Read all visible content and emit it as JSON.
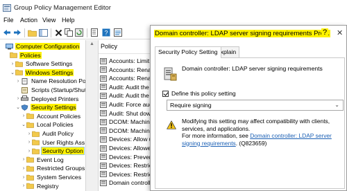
{
  "window": {
    "title": "Group Policy Management Editor"
  },
  "menu": [
    "File",
    "Action",
    "View",
    "Help"
  ],
  "toolbar": {
    "icons": [
      "back-icon",
      "forward-icon",
      "up-folder-icon",
      "show-hide-tree-icon",
      "delete-icon",
      "copy-icon",
      "refresh-icon",
      "export-list-icon",
      "help-icon",
      "properties-icon"
    ]
  },
  "tree": {
    "items": [
      {
        "label": "Computer Configuration",
        "level": 0,
        "expander": "",
        "icon": "computer-icon",
        "highlight": true
      },
      {
        "label": "Policies",
        "level": 1,
        "expander": "",
        "icon": "folder-icon",
        "highlight": true
      },
      {
        "label": "Software Settings",
        "level": 2,
        "expander": ">",
        "icon": "folder-icon",
        "highlight": false
      },
      {
        "label": "Windows Settings",
        "level": 2,
        "expander": "v",
        "icon": "folder-icon",
        "highlight": true
      },
      {
        "label": "Name Resolution Polic",
        "level": 3,
        "expander": ">",
        "icon": "document-icon",
        "highlight": false
      },
      {
        "label": "Scripts (Startup/Shutd",
        "level": 3,
        "expander": "",
        "icon": "scroll-icon",
        "highlight": false
      },
      {
        "label": "Deployed Printers",
        "level": 3,
        "expander": ">",
        "icon": "printer-icon",
        "highlight": false
      },
      {
        "label": "Security Settings",
        "level": 3,
        "expander": "v",
        "icon": "shield-icon",
        "highlight": true
      },
      {
        "label": "Account Policies",
        "level": 4,
        "expander": ">",
        "icon": "folder-icon",
        "highlight": false
      },
      {
        "label": "Local Policies",
        "level": 4,
        "expander": "v",
        "icon": "folder-icon",
        "highlight": false
      },
      {
        "label": "Audit Policy",
        "level": 5,
        "expander": ">",
        "icon": "folder-icon",
        "highlight": false
      },
      {
        "label": "User Rights Ass",
        "level": 5,
        "expander": ">",
        "icon": "folder-icon",
        "highlight": false
      },
      {
        "label": "Security Option",
        "level": 5,
        "expander": ">",
        "icon": "folder-icon",
        "highlight": true,
        "selected": true
      },
      {
        "label": "Event Log",
        "level": 4,
        "expander": ">",
        "icon": "folder-icon",
        "highlight": false
      },
      {
        "label": "Restricted Groups",
        "level": 4,
        "expander": ">",
        "icon": "folder-icon",
        "highlight": false
      },
      {
        "label": "System Services",
        "level": 4,
        "expander": ">",
        "icon": "folder-icon",
        "highlight": false
      },
      {
        "label": "Registry",
        "level": 4,
        "expander": ">",
        "icon": "folder-icon",
        "highlight": false
      }
    ]
  },
  "policy_list": {
    "header": "Policy",
    "rows": [
      "Accounts: Limit",
      "Accounts: Renar",
      "Accounts: Renar",
      "Audit: Audit the",
      "Audit: Audit the",
      "Audit: Force aud",
      "Audit: Shut dow",
      "DCOM: Machine",
      "DCOM: Machine",
      "Devices: Allow u",
      "Devices: Allowed",
      "Devices: Prevent",
      "Devices: Restrict",
      "Devices: Restrict",
      "Domain controlle"
    ]
  },
  "dialog": {
    "title": "Domain controller: LDAP server signing requirements Pro...",
    "help_label": "?",
    "close_label": "✕",
    "tabs": [
      {
        "label": "Security Policy Setting",
        "active": true
      },
      {
        "label": "Explain",
        "active": false
      }
    ],
    "policy_name": "Domain controller: LDAP server signing requirements",
    "define_label": "Define this policy setting",
    "define_checked": true,
    "selected_value": "Require signing",
    "warning": {
      "text": "Modifying this setting may affect compatibility with clients, services, and applications.",
      "more_info_prefix": "For more information, see ",
      "link_text": "Domain controller: LDAP server signing requirements",
      "suffix": ". (Q823659)"
    }
  },
  "colors": {
    "highlight": "#fff200",
    "selection": "#cce8ff",
    "link": "#1a5fb4"
  }
}
